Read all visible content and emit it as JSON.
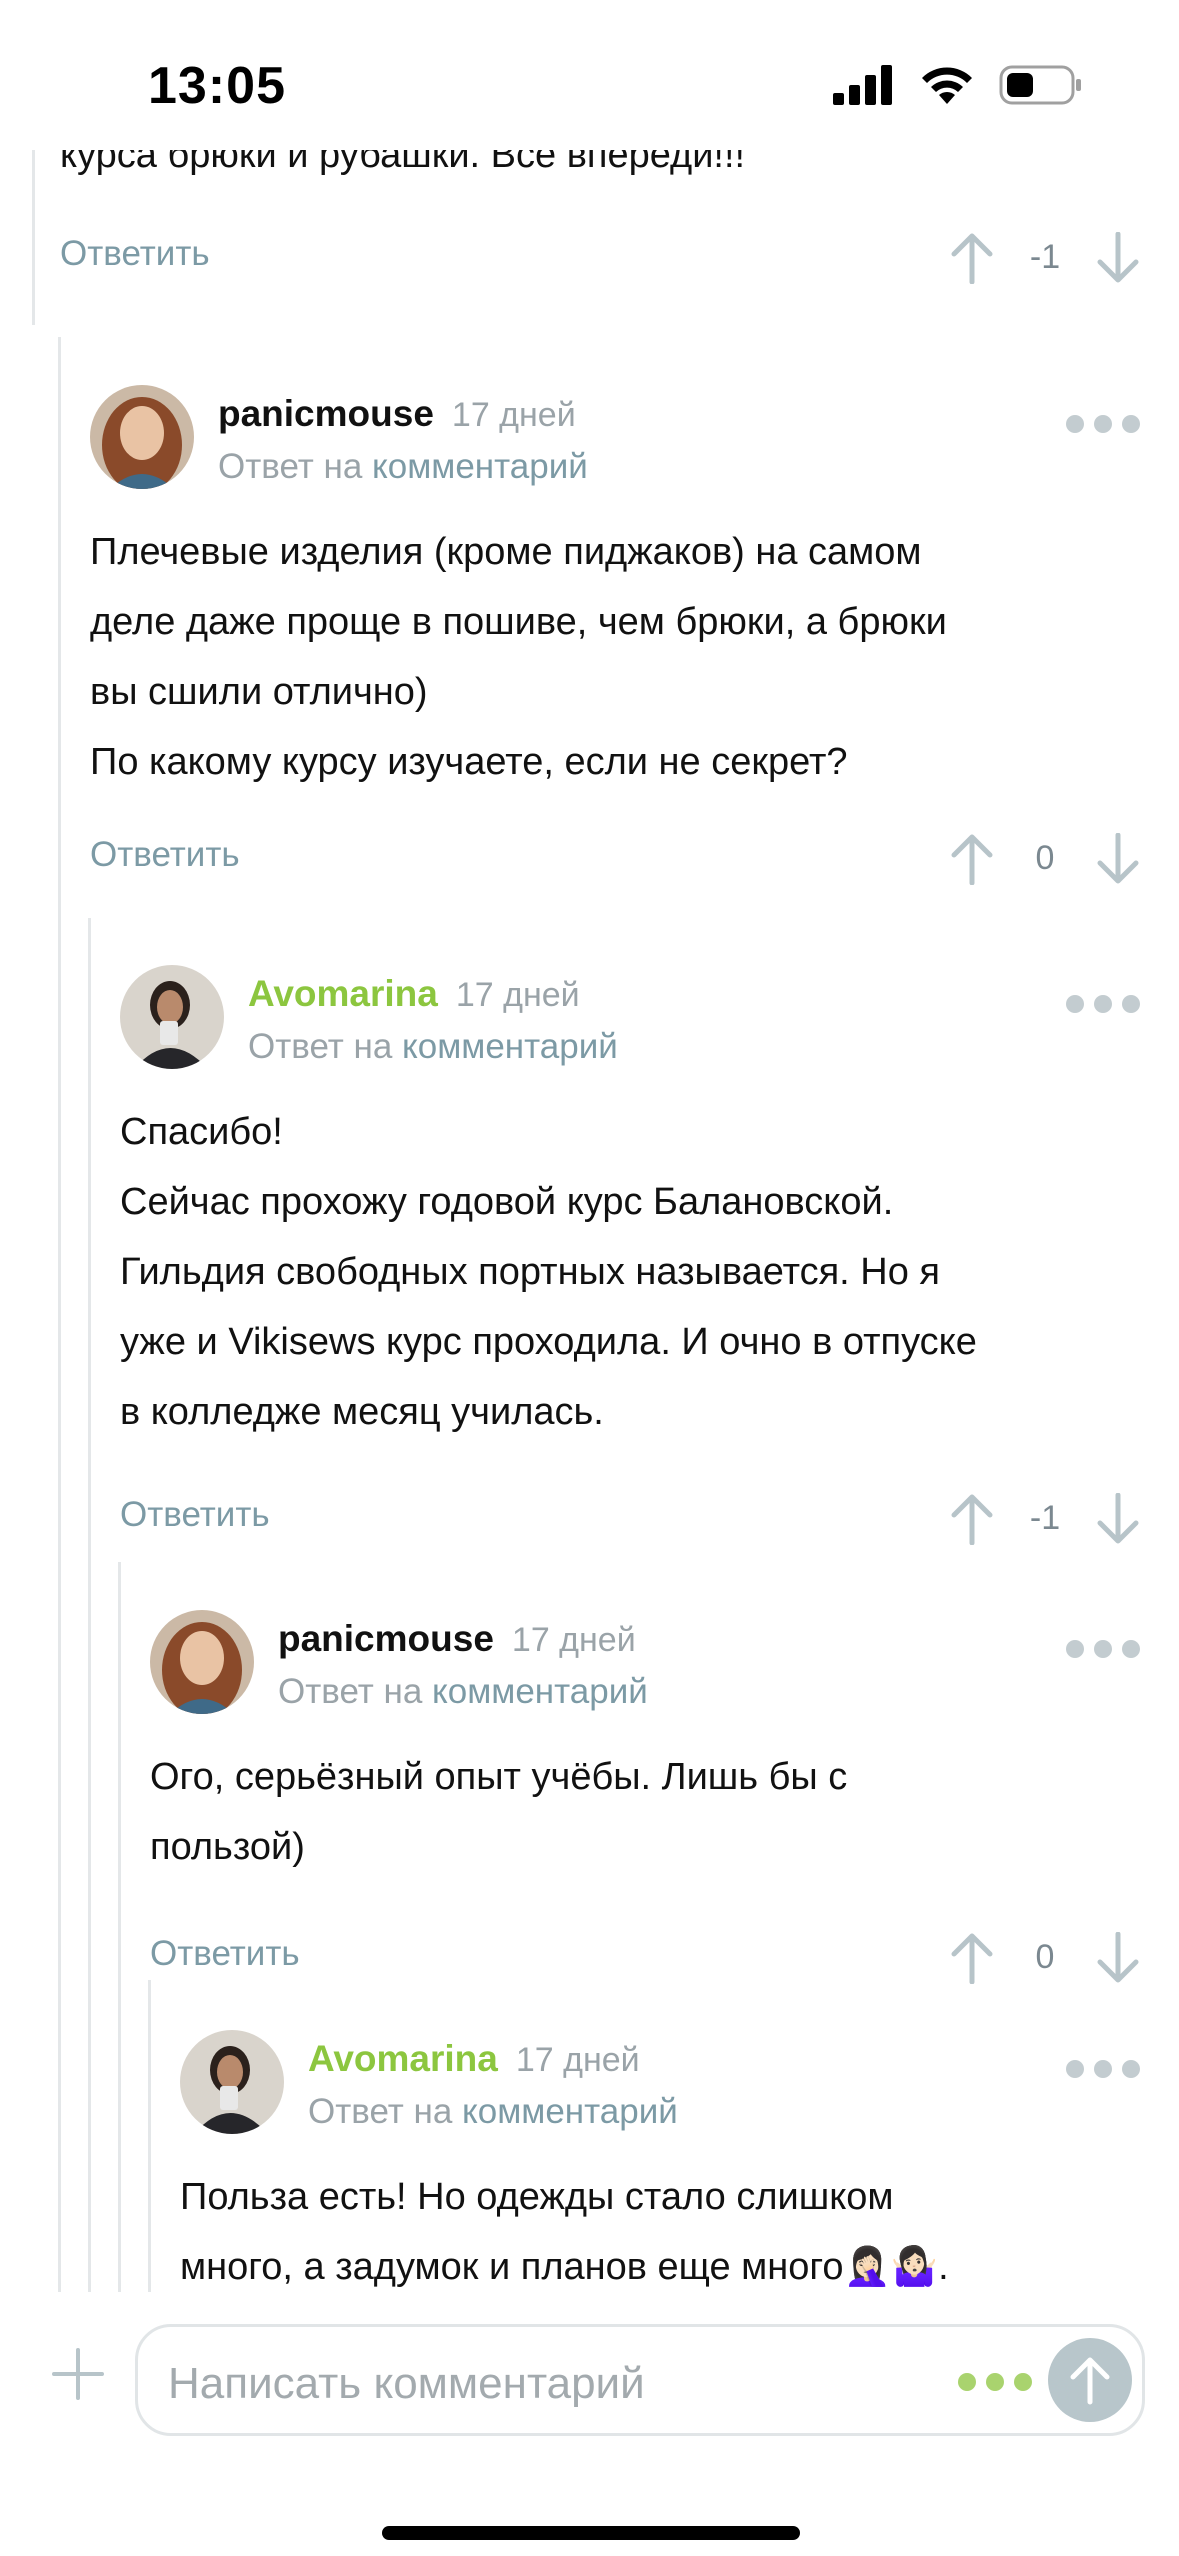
{
  "status_bar": {
    "time": "13:05"
  },
  "top_fragment": {
    "text": "курса брюки и рубашки. Все впереди!!!",
    "reply_label": "Ответить",
    "score": "-1"
  },
  "comments": [
    {
      "author": "panicmouse",
      "time": "17 дней",
      "reply_prefix": "Ответ на",
      "reply_link": "комментарий",
      "lines": [
        "Плечевые изделия (кроме пиджаков) на самом",
        "деле даже проще в пошиве, чем брюки, а брюки",
        "вы сшили отлично)",
        "По какому курсу изучаете, если не секрет?"
      ],
      "reply_label": "Ответить",
      "score": "0"
    },
    {
      "author": "Avomarina",
      "time": "17 дней",
      "reply_prefix": "Ответ на",
      "reply_link": "комментарий",
      "lines": [
        "Спасибо!",
        "Сейчас прохожу годовой курс Балановской.",
        "Гильдия свободных портных называется. Но я",
        "уже и Vikisews курс проходила. И очно в отпуске",
        "в колледже месяц училась."
      ],
      "reply_label": "Ответить",
      "score": "-1"
    },
    {
      "author": "panicmouse",
      "time": "17 дней",
      "reply_prefix": "Ответ на",
      "reply_link": "комментарий",
      "lines": [
        "Ого, серьёзный опыт учёбы. Лишь бы с",
        "пользой)"
      ],
      "reply_label": "Ответить",
      "score": "0"
    },
    {
      "author": "Avomarina",
      "time": "17 дней",
      "reply_prefix": "Ответ на",
      "reply_link": "комментарий",
      "lines": [
        "Польза есть! Но одежды стало слишком",
        "много, а задумок и планов еще много🤦🏻‍♀️🤷🏻‍♀️."
      ]
    }
  ],
  "composer": {
    "placeholder": "Написать комментарий"
  },
  "colors": {
    "green_author": "#8cc63f",
    "link": "#7c9aa5",
    "muted": "#9aa3a8",
    "vote_arrow": "#b7c4c9"
  }
}
